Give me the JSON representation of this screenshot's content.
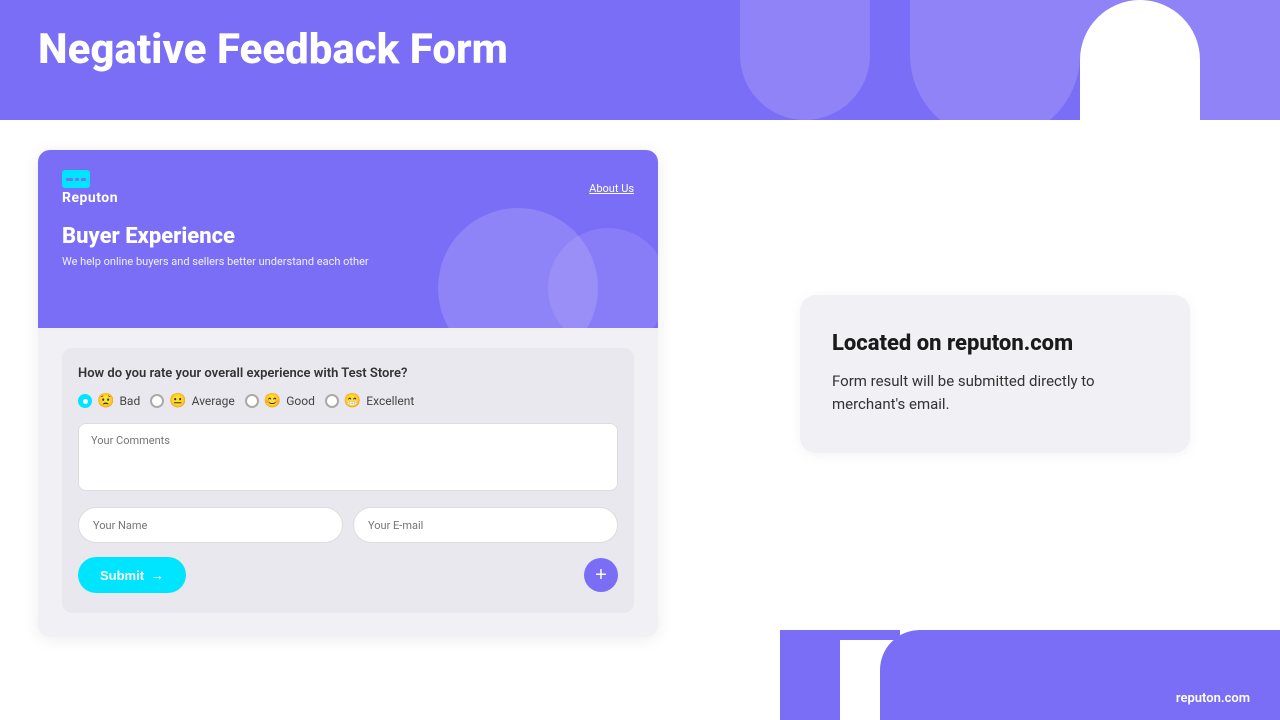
{
  "page": {
    "title": "Negative Feedback Form"
  },
  "header": {
    "title": "Negative Feedback Form"
  },
  "form_card": {
    "brand": {
      "name": "Reputon",
      "nav_link": "About Us"
    },
    "hero": {
      "title": "Buyer Experience",
      "subtitle": "We help online buyers and sellers better understand each other"
    },
    "form": {
      "question": "How do you rate your overall experience with Test Store?",
      "rating_options": [
        {
          "label": "Bad",
          "emoji": "😟",
          "selected": true
        },
        {
          "label": "Average",
          "emoji": "😐",
          "selected": false
        },
        {
          "label": "Good",
          "emoji": "😊",
          "selected": false
        },
        {
          "label": "Excellent",
          "emoji": "😁",
          "selected": false
        }
      ],
      "comments_placeholder": "Your Comments",
      "name_placeholder": "Your Name",
      "email_placeholder": "Your E-mail",
      "submit_label": "Submit",
      "submit_arrow": "→"
    }
  },
  "info_card": {
    "title": "Located on reputon.com",
    "description": "Form result will be submitted directly to merchant's email."
  },
  "bottom_logo": "reputon.com"
}
